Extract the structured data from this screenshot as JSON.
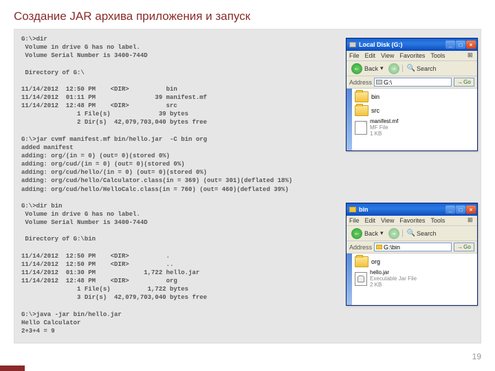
{
  "slide": {
    "title": "Создание JAR архива приложения и запуск",
    "page_number": "19"
  },
  "console_text": "G:\\>dir\n Volume in drive G has no label.\n Volume Serial Number is 3400-744D\n\n Directory of G:\\\n\n11/14/2012  12:50 PM    <DIR>          bin\n11/14/2012  01:11 PM                39 manifest.mf\n11/14/2012  12:48 PM    <DIR>          src\n               1 File(s)             39 bytes\n               2 Dir(s)  42,079,703,040 bytes free\n\nG:\\>jar cvmf manifest.mf bin/hello.jar  -C bin org\nadded manifest\nadding: org/(in = 0) (out= 0)(stored 0%)\nadding: org/cud/(in = 0) (out= 0)(stored 0%)\nadding: org/cud/hello/(in = 0) (out= 0)(stored 0%)\nadding: org/cud/hello/Calculator.class(in = 369) (out= 301)(deflated 18%)\nadding: org/cud/hello/HelloCalc.class(in = 760) (out= 460)(deflated 39%)\n\nG:\\>dir bin\n Volume in drive G has no label.\n Volume Serial Number is 3400-744D\n\n Directory of G:\\bin\n\n11/14/2012  12:50 PM    <DIR>          .\n11/14/2012  12:50 PM    <DIR>          ..\n11/14/2012  01:30 PM             1,722 hello.jar\n11/14/2012  12:48 PM    <DIR>          org\n               1 File(s)          1,722 bytes\n               3 Dir(s)  42,079,703,040 bytes free\n\nG:\\>java -jar bin/hello.jar\nHello Calculator\n2+3+4 = 9\n",
  "explorer1": {
    "title": "Local Disk (G:)",
    "menu": {
      "file": "File",
      "edit": "Edit",
      "view": "View",
      "favorites": "Favorites",
      "tools": "Tools"
    },
    "toolbar": {
      "back": "Back",
      "search": "Search"
    },
    "address": {
      "label": "Address",
      "path": "G:\\",
      "go": "Go"
    },
    "files": {
      "bin": "bin",
      "src": "src",
      "mf": {
        "name": "manifest.mf",
        "type": "MF File",
        "size": "1 KB"
      }
    }
  },
  "explorer2": {
    "title": "bin",
    "menu": {
      "file": "File",
      "edit": "Edit",
      "view": "View",
      "favorites": "Favorites",
      "tools": "Tools"
    },
    "toolbar": {
      "back": "Back",
      "search": "Search"
    },
    "address": {
      "label": "Address",
      "path": "G:\\bin",
      "go": "Go"
    },
    "files": {
      "org": "org",
      "jar": {
        "name": "hello.jar",
        "type": "Executable Jar File",
        "size": "2 KB"
      }
    }
  }
}
